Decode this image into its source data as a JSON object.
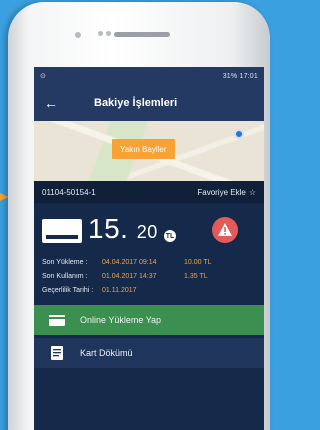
{
  "status_bar": {
    "right": "31% 17:01"
  },
  "app_bar": {
    "title": "Bakiye İşlemleri"
  },
  "map": {
    "button_label": "Yakın Bayiler"
  },
  "card": {
    "number": "01104-50154-1",
    "favorite_label": "Favoriye Ekle"
  },
  "balance": {
    "integer": "15.",
    "decimal": "20",
    "currency_badge": "TL"
  },
  "info": {
    "rows": [
      {
        "label": "Son Yükleme :",
        "date": "04.04.2017 09:14",
        "value": "10.00 TL"
      },
      {
        "label": "Son Kullanım :",
        "date": "01.04.2017 14:37",
        "value": "1.35 TL"
      },
      {
        "label": "Geçerlilik Tarihi :",
        "date": "01.11.2017",
        "value": ""
      }
    ]
  },
  "menu": [
    {
      "label": "Online Yükleme Yap"
    },
    {
      "label": "Kart Dökümü"
    }
  ],
  "colors": {
    "accent": "#f4a33a",
    "green": "#3b8f4f",
    "navy": "#15294a"
  }
}
